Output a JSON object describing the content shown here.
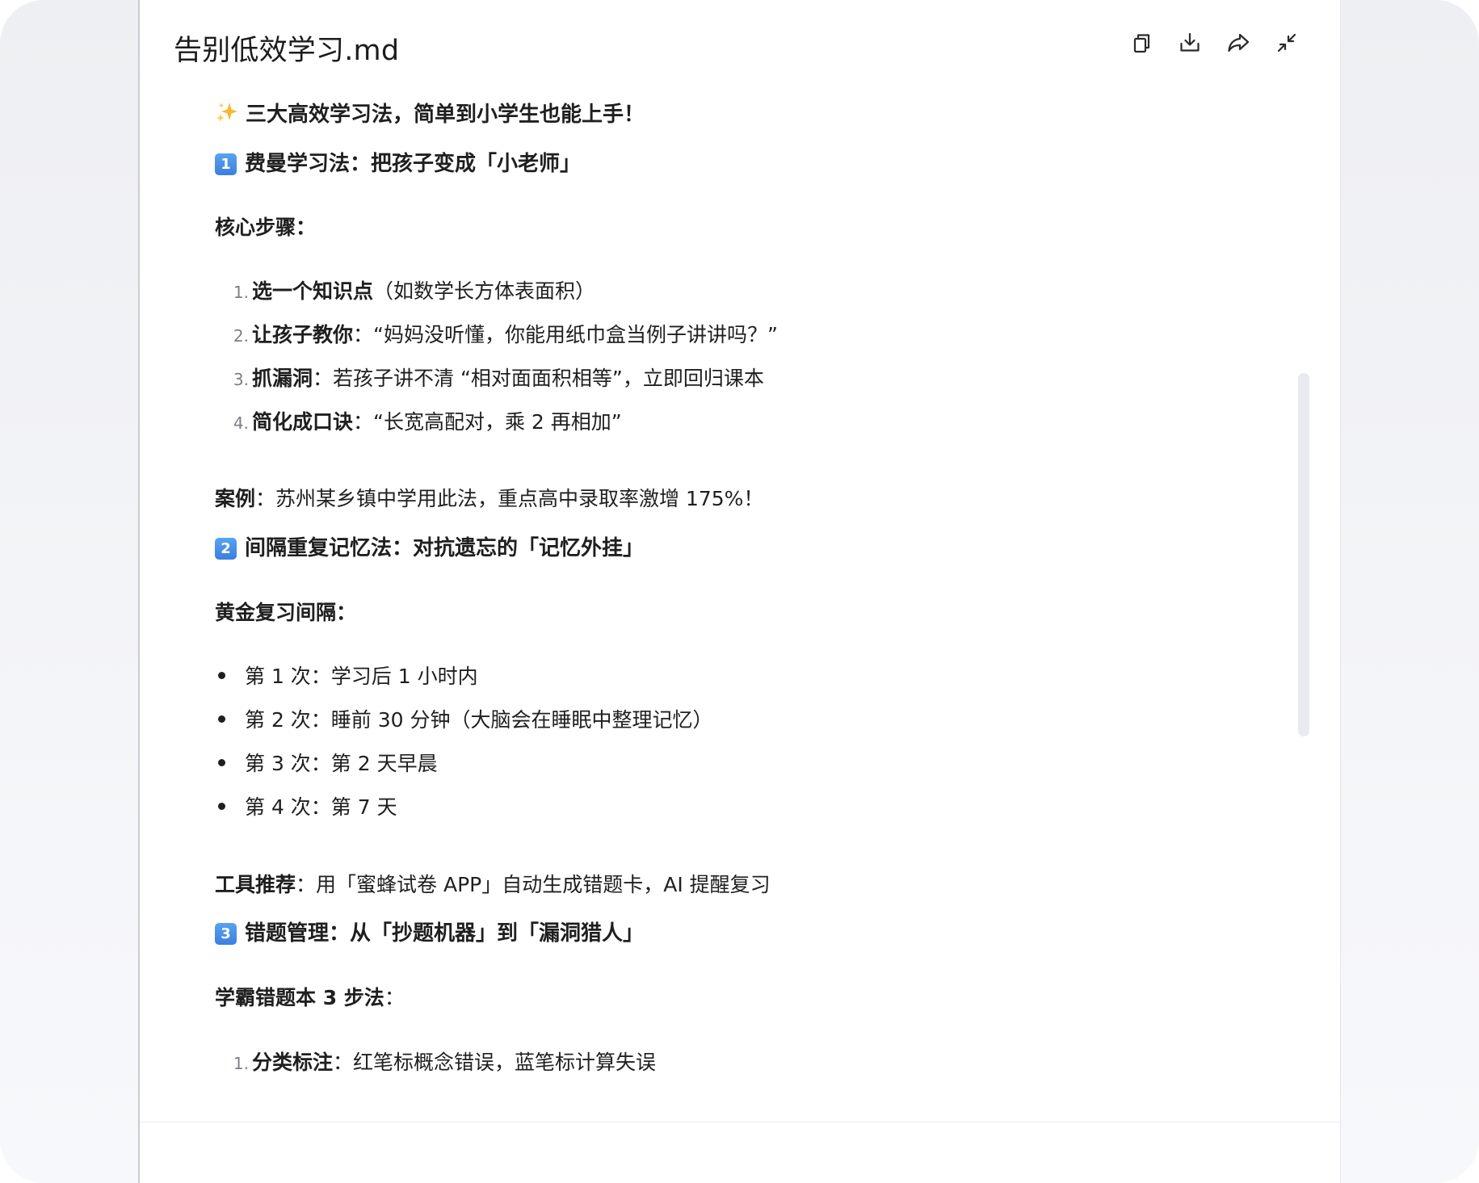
{
  "document": {
    "title": "告别低效学习.md"
  },
  "toolbar": {
    "icons": [
      "copy-icon",
      "download-icon",
      "share-icon",
      "collapse-icon"
    ]
  },
  "content": {
    "intro": "三大高效学习法，简单到小学生也能上手！",
    "sections": [
      {
        "badge": "1",
        "heading": "费曼学习法：把孩子变成「小老师」",
        "sub_label": "核心步骤：",
        "steps": [
          {
            "num": "1.",
            "bold": "选一个知识点",
            "text": "（如数学长方体表面积）"
          },
          {
            "num": "2.",
            "bold": "让孩子教你",
            "text": "：“妈妈没听懂，你能用纸巾盒当例子讲讲吗？”"
          },
          {
            "num": "3.",
            "bold": "抓漏洞",
            "text": "：若孩子讲不清 “相对面面积相等”，立即回归课本"
          },
          {
            "num": "4.",
            "bold": "简化成口诀",
            "text": "：“长宽高配对，乘 2 再相加”"
          }
        ],
        "note_label": "案例",
        "note_text": "：苏州某乡镇中学用此法，重点高中录取率激增 175%！"
      },
      {
        "badge": "2",
        "heading": "间隔重复记忆法：对抗遗忘的「记忆外挂」",
        "sub_label": "黄金复习间隔：",
        "bullets": [
          "第 1 次：学习后 1 小时内",
          "第 2 次：睡前 30 分钟（大脑会在睡眠中整理记忆）",
          "第 3 次：第 2 天早晨",
          "第 4 次：第 7 天"
        ],
        "note_label": "工具推荐",
        "note_text": "：用「蜜蜂试卷 APP」自动生成错题卡，AI 提醒复习"
      },
      {
        "badge": "3",
        "heading": "错题管理：从「抄题机器」到「漏洞猎人」",
        "sub_label_bold": "学霸错题本 3 步法",
        "sub_label_tail": "：",
        "steps": [
          {
            "num": "1.",
            "bold": "分类标注",
            "text": "：红笔标概念错误，蓝笔标计算失误"
          }
        ]
      }
    ]
  }
}
